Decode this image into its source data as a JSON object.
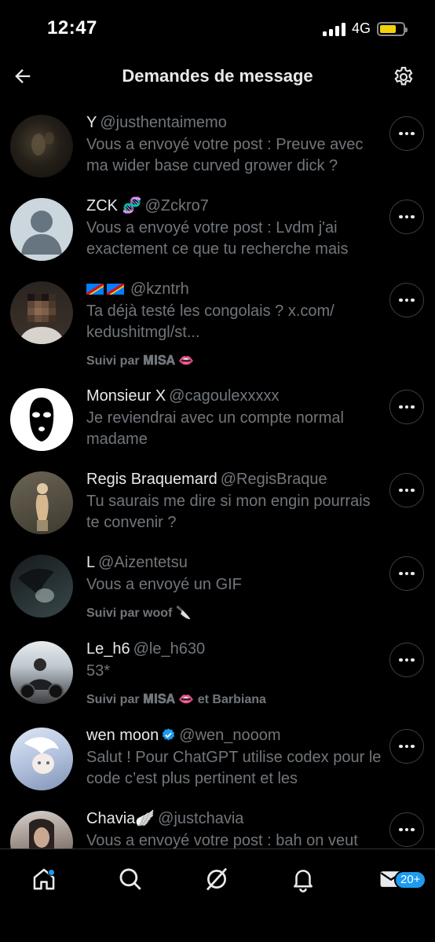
{
  "status": {
    "time": "12:47",
    "network": "4G"
  },
  "header": {
    "title": "Demandes de message"
  },
  "requests": [
    {
      "name": "Y",
      "handle": "@justhentaimemo",
      "preview": "Vous a envoyé votre post : Preuve avec ma wider base curved grower dick ?",
      "followed": ""
    },
    {
      "name": "ZCK 🧬",
      "handle": "@Zckro7",
      "preview": "Vous a envoyé votre post : Lvdm j'ai exactement ce que tu recherche mais",
      "followed": ""
    },
    {
      "name": "🇨🇩🇨🇩",
      "handle": "@kzntrh",
      "preview": "Ta déjà testé les congolais ? x.com/ kedushitmgl/st...",
      "followed": "Suivi par 𝐌𝐈𝐒𝐀 👄"
    },
    {
      "name": "Monsieur X",
      "handle": "@cagoulexxxxx",
      "preview": "Je reviendrai avec un compte normal madame",
      "followed": ""
    },
    {
      "name": "Regis Braquemard",
      "handle": "@RegisBraque",
      "preview": "Tu saurais me dire si mon engin pourrais te convenir ?",
      "followed": ""
    },
    {
      "name": "L",
      "handle": "@Aizentetsu",
      "preview": "Vous a envoyé un GIF",
      "followed": "Suivi par woof 🔪"
    },
    {
      "name": "Le_h6",
      "handle": "@le_h630",
      "preview": "53*",
      "followed": "Suivi par 𝐌𝐈𝐒𝐀 👄 et Barbiana"
    },
    {
      "name": "wen moon",
      "handle": "@wen_nooom",
      "preview": "Salut ! Pour ChatGPT utilise codex pour le code c’est plus pertinent et les",
      "followed": ""
    },
    {
      "name": "Chavia🪽",
      "handle": "@justchavia",
      "preview": "Vous a envoyé votre post : bah on veut",
      "followed": ""
    }
  ],
  "tabs": {
    "home": "home-icon",
    "search": "search-icon",
    "grok": "grok-icon",
    "notifications": "bell-icon",
    "messages": "envelope-icon",
    "messages_badge": "20+"
  },
  "colors": {
    "accent": "#1d9bf0",
    "background": "#000000",
    "muted": "#71767b",
    "text": "#e7e9ea"
  }
}
